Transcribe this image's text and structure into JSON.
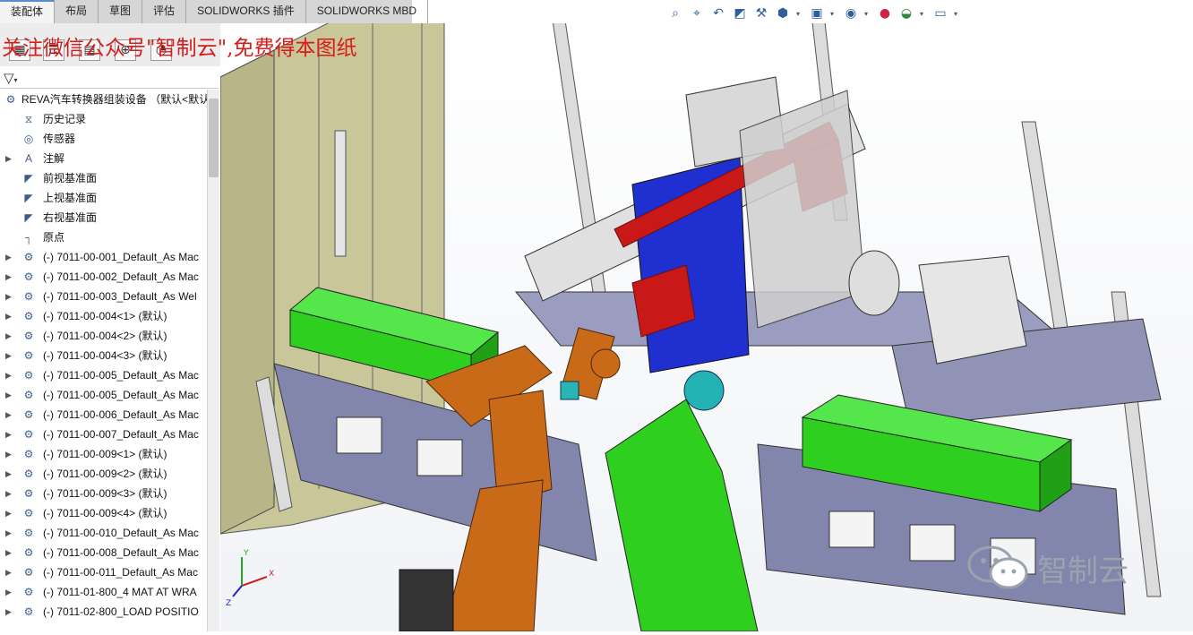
{
  "tabs": [
    "装配体",
    "布局",
    "草图",
    "评估",
    "SOLIDWORKS 插件",
    "SOLIDWORKS MBD"
  ],
  "active_tab": "装配体",
  "view_toolbar_icons": [
    "zoom-to-fit-icon",
    "zoom-to-area-icon",
    "previous-view-icon",
    "section-view-icon",
    "dynamic-annotation-icon",
    "view-orientation-icon",
    "display-style-icon",
    "hide-show-items-icon",
    "edit-appearance-icon",
    "apply-scene-icon",
    "view-settings-icon"
  ],
  "panel": {
    "tab_icons": [
      "feature-manager-icon",
      "property-manager-icon",
      "configuration-manager-icon",
      "dimxpert-manager-icon",
      "display-manager-icon"
    ],
    "filter_icon": "filter-icon",
    "root": "REVA汽车转换器组装设备 （默认<默认",
    "items": [
      {
        "label": "历史记录",
        "icon": "history-icon",
        "expandable": false
      },
      {
        "label": "传感器",
        "icon": "sensor-icon",
        "expandable": false
      },
      {
        "label": "注解",
        "icon": "annotation-icon",
        "expandable": true
      },
      {
        "label": "前视基准面",
        "icon": "plane-icon",
        "expandable": false
      },
      {
        "label": "上视基准面",
        "icon": "plane-icon",
        "expandable": false
      },
      {
        "label": "右视基准面",
        "icon": "plane-icon",
        "expandable": false
      },
      {
        "label": "原点",
        "icon": "origin-icon",
        "expandable": false
      },
      {
        "label": "(-) 7011-00-001_Default_As Mac",
        "icon": "subassembly-icon",
        "expandable": true
      },
      {
        "label": "(-) 7011-00-002_Default_As Mac",
        "icon": "subassembly-icon",
        "expandable": true
      },
      {
        "label": "(-) 7011-00-003_Default_As Wel",
        "icon": "subassembly-icon",
        "expandable": true
      },
      {
        "label": "(-) 7011-00-004<1> (默认)",
        "icon": "subassembly-icon",
        "expandable": true
      },
      {
        "label": "(-) 7011-00-004<2> (默认)",
        "icon": "subassembly-icon",
        "expandable": true
      },
      {
        "label": "(-) 7011-00-004<3> (默认)",
        "icon": "subassembly-icon",
        "expandable": true
      },
      {
        "label": "(-) 7011-00-005_Default_As Mac",
        "icon": "subassembly-icon",
        "expandable": true
      },
      {
        "label": "(-) 7011-00-005_Default_As Mac",
        "icon": "subassembly-icon",
        "expandable": true
      },
      {
        "label": "(-) 7011-00-006_Default_As Mac",
        "icon": "subassembly-icon",
        "expandable": true
      },
      {
        "label": "(-) 7011-00-007_Default_As Mac",
        "icon": "subassembly-icon",
        "expandable": true
      },
      {
        "label": "(-) 7011-00-009<1> (默认)",
        "icon": "subassembly-icon",
        "expandable": true
      },
      {
        "label": "(-) 7011-00-009<2> (默认)",
        "icon": "subassembly-icon",
        "expandable": true
      },
      {
        "label": "(-) 7011-00-009<3> (默认)",
        "icon": "subassembly-icon",
        "expandable": true
      },
      {
        "label": "(-) 7011-00-009<4> (默认)",
        "icon": "subassembly-icon",
        "expandable": true
      },
      {
        "label": "(-) 7011-00-010_Default_As Mac",
        "icon": "subassembly-icon",
        "expandable": true
      },
      {
        "label": "(-) 7011-00-008_Default_As Mac",
        "icon": "subassembly-icon",
        "expandable": true
      },
      {
        "label": "(-) 7011-00-011_Default_As Mac",
        "icon": "subassembly-icon",
        "expandable": true
      },
      {
        "label": "(-) 7011-01-800_4 MAT AT WRA",
        "icon": "subassembly-icon",
        "expandable": true
      },
      {
        "label": "(-) 7011-02-800_LOAD POSITIO",
        "icon": "subassembly-icon",
        "expandable": true
      }
    ]
  },
  "watermark": "关注微信公众号\"智制云\",免费得本图纸",
  "logo_text": "智制云",
  "triad_labels": [
    "X",
    "Y",
    "Z"
  ],
  "colors": {
    "accent": "#5a8ed0",
    "watermark": "#d81b1b",
    "model_green": "#2fcf1f",
    "model_blue": "#1f2fd0",
    "model_orange": "#c96a18",
    "model_red": "#c81818",
    "frame_purple": "#7c7fa8"
  }
}
